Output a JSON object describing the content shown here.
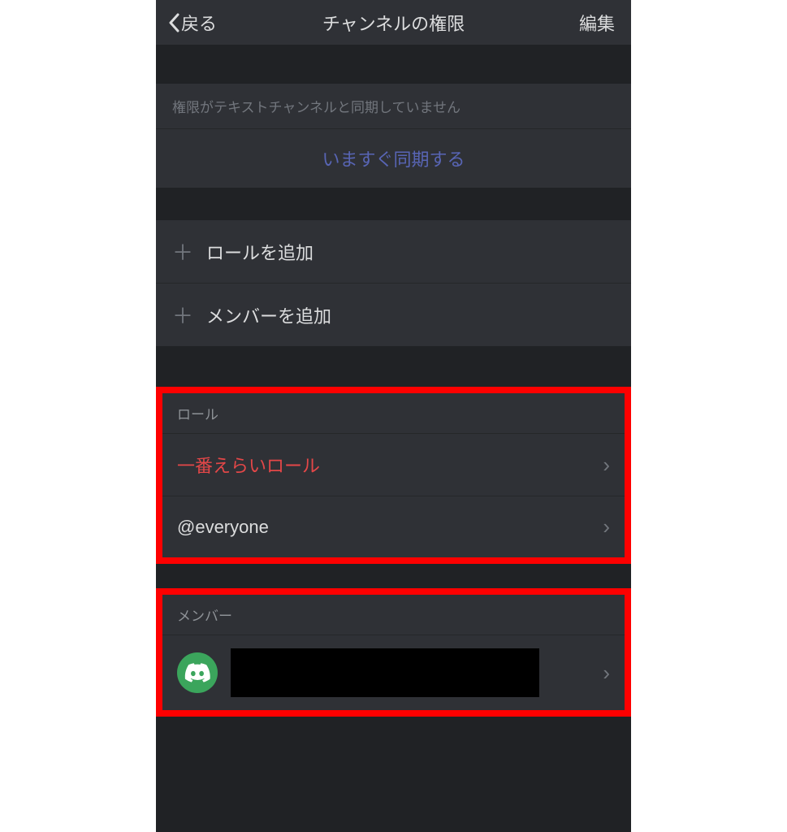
{
  "header": {
    "back_label": "戻る",
    "title": "チャンネルの権限",
    "edit_label": "編集"
  },
  "sync": {
    "note": "権限がテキストチャンネルと同期していません",
    "action_label": "いますぐ同期する"
  },
  "add_actions": {
    "role_label": "ロールを追加",
    "member_label": "メンバーを追加"
  },
  "roles_section": {
    "header": "ロール",
    "items": [
      {
        "label": "一番えらいロール",
        "color": "red"
      },
      {
        "label": "@everyone",
        "color": "normal"
      }
    ]
  },
  "members_section": {
    "header": "メンバー"
  }
}
